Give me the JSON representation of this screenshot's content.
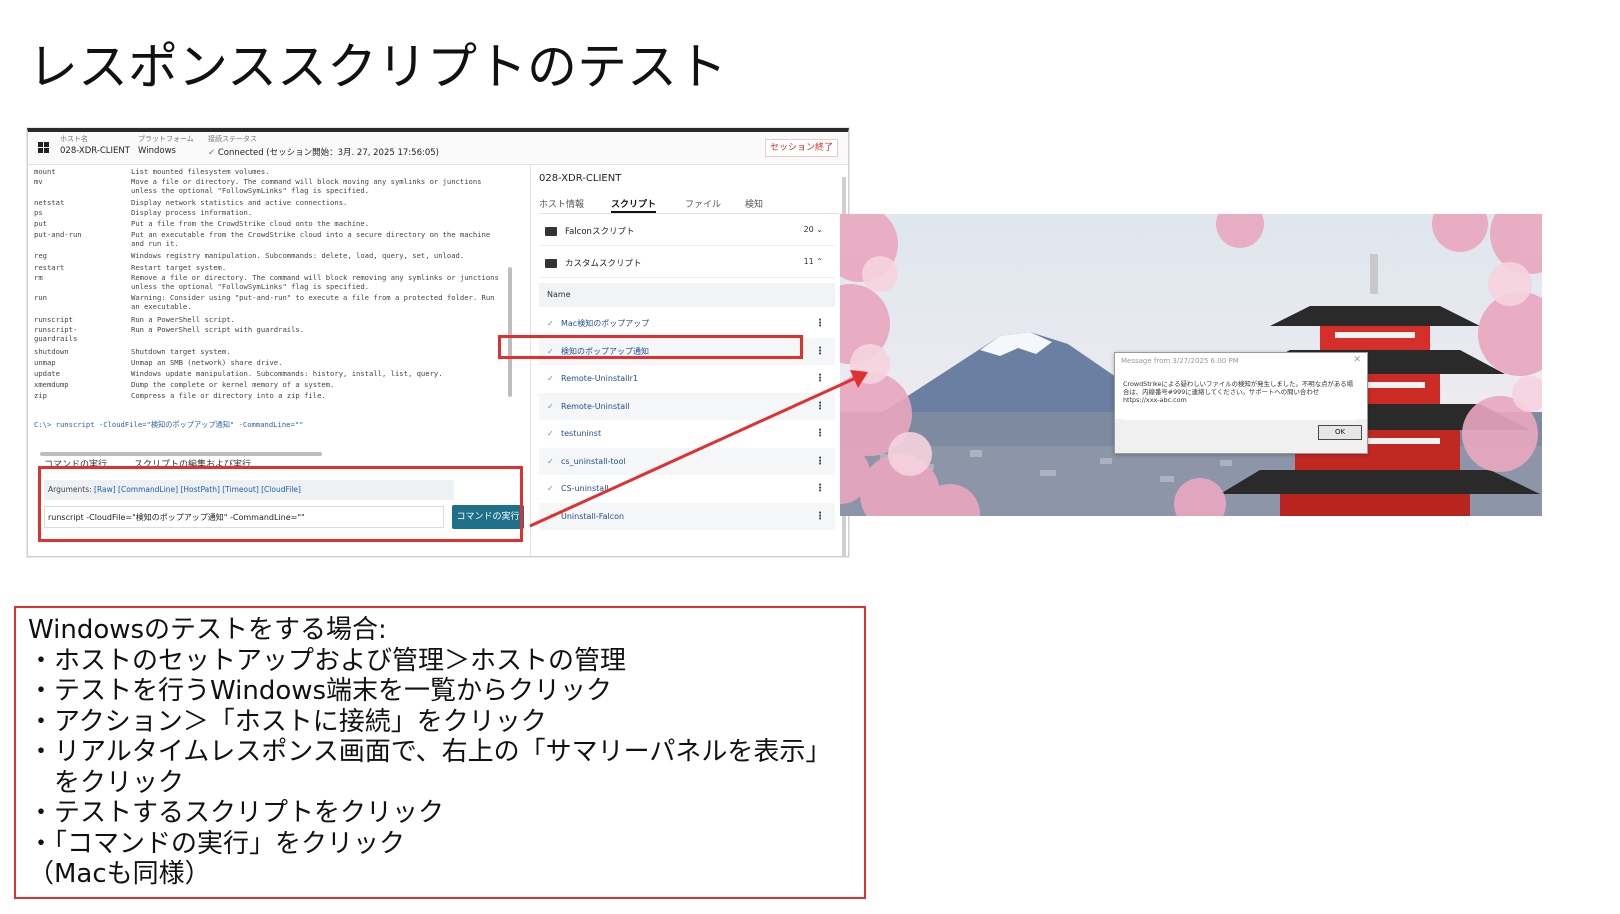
{
  "slide": {
    "title": "レスポンススクリプトのテスト"
  },
  "session_bar": {
    "host_label": "ホスト名",
    "host_value": "028-XDR-CLIENT",
    "platform_label": "プラットフォーム",
    "platform_value": "Windows",
    "status_label": "接続ステータス",
    "status_value": "Connected (セッション開始：3月. 27, 2025 17:56:05)",
    "end_session": "セッション終了"
  },
  "terminal": {
    "commands": [
      {
        "name": "mount",
        "desc": "List mounted filesystem volumes."
      },
      {
        "name": "mv",
        "desc": "Move a file or directory. The command will block moving any symlinks or junctions unless the optional \"FollowSymLinks\" flag is specified."
      },
      {
        "name": "netstat",
        "desc": "Display network statistics and active connections."
      },
      {
        "name": "ps",
        "desc": "Display process information."
      },
      {
        "name": "put",
        "desc": "Put a file from the CrowdStrike cloud onto the machine."
      },
      {
        "name": "put-and-run",
        "desc": "Put an executable from the CrowdStrike cloud into a secure directory on the machine and run it."
      },
      {
        "name": "reg",
        "desc": "Windows registry manipulation. Subcommands: delete, load, query, set, unload."
      },
      {
        "name": "restart",
        "desc": "Restart target system."
      },
      {
        "name": "rm",
        "desc": "Remove a file or directory. The command will block removing any symlinks or junctions unless the optional \"FollowSymLinks\" flag is specified."
      },
      {
        "name": "run",
        "desc": "Warning: Consider using \"put-and-run\" to execute a file from a protected folder. Run an executable."
      },
      {
        "name": "runscript",
        "desc": "Run a PowerShell script."
      },
      {
        "name": "runscript-guardrails",
        "desc": "Run a PowerShell script with guardrails."
      },
      {
        "name": "shutdown",
        "desc": "Shutdown target system."
      },
      {
        "name": "unmap",
        "desc": "Unmap an SMB (network) share drive."
      },
      {
        "name": "update",
        "desc": "Windows update manipulation. Subcommands: history, install, list, query."
      },
      {
        "name": "xmemdump",
        "desc": "Dump the complete or kernel memory of a system."
      },
      {
        "name": "zip",
        "desc": "Compress a file or directory into a zip file."
      }
    ],
    "prompt": "C:\\> runscript -CloudFile=\"検知のポップアップ通知\" -CommandLine=\"\""
  },
  "command_area": {
    "tab_run": "コマンドの実行",
    "tab_edit": "スクリプトの編集および実行",
    "args_label": "Arguments:",
    "args_links": "[Raw] [CommandLine] [HostPath] [Timeout] [CloudFile]",
    "input_value": "runscript -CloudFile=\"検知のポップアップ通知\" -CommandLine=\"\"",
    "run_button": "コマンドの実行"
  },
  "summary_panel": {
    "title": "028-XDR-CLIENT",
    "tabs": [
      "ホスト情報",
      "スクリプト",
      "ファイル",
      "検知"
    ],
    "folders": [
      {
        "label": "Falconスクリプト",
        "count": "20 ⌄"
      },
      {
        "label": "カスタムスクリプト",
        "count": "11 ⌃"
      }
    ],
    "column_header": "Name",
    "scripts": [
      "Mac検知のポップアップ",
      "検知のポップアップ通知",
      "Remote-Uninstallr1",
      "Remote-Uninstall",
      "testuninst",
      "cs_uninstall-tool",
      "CS-uninstall",
      "Uninstall-Falcon"
    ]
  },
  "popup_dialog": {
    "title": "Message from  3/27/2025 6:00 PM",
    "body": "CrowdStrikeによる疑わしいファイルの検知が発生しました。不明な点がある場合は、内線番号#999に連絡してください。サポートへの問い合わせ https://xxx-abc.com",
    "ok": "OK"
  },
  "notes": [
    "Windowsのテストをする場合:",
    "・ホストのセットアップおよび管理＞ホストの管理",
    "・テストを行うWindows端末を一覧からクリック",
    "・アクション＞「ホストに接続」をクリック",
    "・リアルタイムレスポンス画面で、右上の「サマリーパネルを表示」",
    "　をクリック",
    "・テストするスクリプトをクリック",
    "・「コマンドの実行」をクリック",
    "（Macも同様）"
  ],
  "colors": {
    "highlight": "#e03030",
    "run_button": "#1f6f88"
  }
}
